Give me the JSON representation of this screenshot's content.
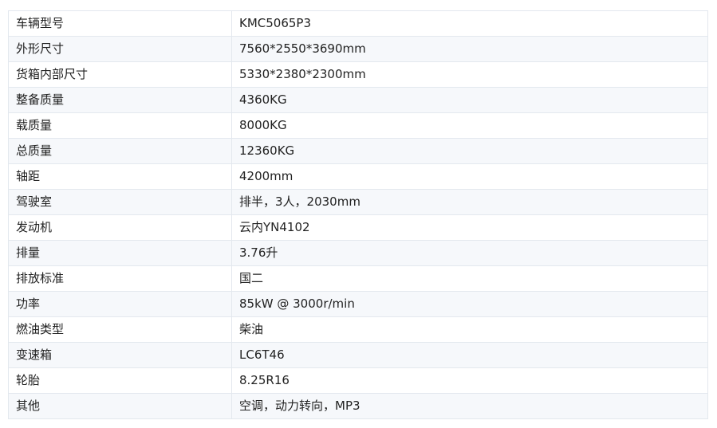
{
  "spec_table": {
    "rows": [
      {
        "label": "车辆型号",
        "value": "KMC5065P3"
      },
      {
        "label": "外形尺寸",
        "value": "7560*2550*3690mm"
      },
      {
        "label": "货箱内部尺寸",
        "value": "5330*2380*2300mm"
      },
      {
        "label": "整备质量",
        "value": "4360KG"
      },
      {
        "label": "载质量",
        "value": "8000KG"
      },
      {
        "label": "总质量",
        "value": "12360KG"
      },
      {
        "label": "轴距",
        "value": "4200mm"
      },
      {
        "label": "驾驶室",
        "value": "排半，3人，2030mm"
      },
      {
        "label": "发动机",
        "value": "云内YN4102"
      },
      {
        "label": "排量",
        "value": "3.76升"
      },
      {
        "label": "排放标准",
        "value": "国二"
      },
      {
        "label": "功率",
        "value": "85kW @ 3000r/min"
      },
      {
        "label": "燃油类型",
        "value": "柴油"
      },
      {
        "label": "变速箱",
        "value": "LC6T46"
      },
      {
        "label": "轮胎",
        "value": "8.25R16"
      },
      {
        "label": "其他",
        "value": "空调，动力转向，MP3"
      }
    ]
  }
}
